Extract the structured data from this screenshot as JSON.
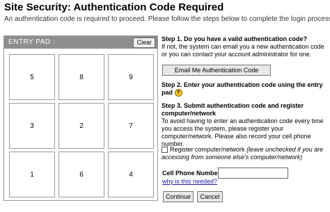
{
  "header": {
    "title": "Site Security: Authentication Code Required",
    "subtitle": "An authentication code is required to proceed. Please follow the steps below to complete the login process."
  },
  "entry_pad": {
    "title": "ENTRY PAD :",
    "clear_label": "Clear",
    "keys": [
      "5",
      "8",
      "9",
      "3",
      "2",
      "7",
      "1",
      "6",
      "4"
    ]
  },
  "step1": {
    "heading": "Step 1. Do you have a valid authentication code?",
    "body": "If not, the system can email you a new authentication code or you can contact your account administrator for one.",
    "email_button": "Email Me Authentication Code"
  },
  "step2": {
    "heading": "Step 2. Enter your authentication code using the entry pad",
    "help_icon": "?"
  },
  "step3": {
    "heading": "Step 3. Submit authentication code and register computer/network",
    "body": "To avoid having to enter an authentication code every time you access the system, please register your computer/network. Please also record your cell phone number.",
    "register_label": "Register computer/network",
    "register_note": "(leave unchecked if you are accessing from someone else's computer/network)",
    "register_checked": false,
    "phone_label": "Cell Phone Number",
    "phone_value": "",
    "why_link": "why is this needed?",
    "continue_label": "Continue",
    "cancel_label": "Cancel"
  }
}
